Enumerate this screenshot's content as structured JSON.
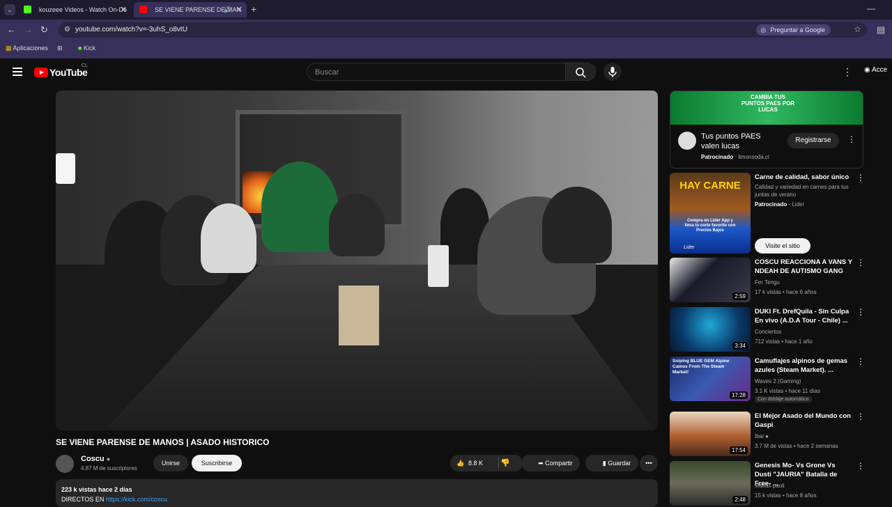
{
  "browser": {
    "tabs": [
      {
        "title": "kouzeee Videos - Watch On-De",
        "active": false,
        "favicon_color": "#53fc18"
      },
      {
        "title": "SE VIENE PARENSE DE MAN",
        "active": true,
        "favicon_color": "#ff0000"
      }
    ],
    "url": "youtube.com/watch?v=-3uhS_o8vtU",
    "ask_google": "Preguntar a Google",
    "bookmarks": [
      {
        "label": "Aplicaciones",
        "icon": "apps-icon"
      },
      {
        "label": "Kick",
        "icon": "kick-icon"
      }
    ]
  },
  "youtube": {
    "logo_text": "YouTube",
    "country": "CL",
    "search_placeholder": "Buscar",
    "account_label": "Acce"
  },
  "video": {
    "title": "SE VIENE PARENSE DE MANOS | ASADO HISTORICO",
    "channel": "Coscu",
    "subscribers": "4.87 M de suscriptores",
    "join_label": "Unirse",
    "subscribe_label": "Suscribirse",
    "likes": "8.8 K",
    "share_label": "Compartir",
    "save_label": "Guardar",
    "description_stats": "223 k vistas  hace 2 días",
    "description_prefix": "DIRECTOS EN ",
    "description_link": "https://kick.com/coscu"
  },
  "ad": {
    "banner_text": "CAMBIA TUS PUNTOS PAES POR LUCAS",
    "title": "Tus puntos PAES valen lucas",
    "sponsored": "Patrocinado",
    "domain": "limonsoda.cl",
    "button": "Registrarse"
  },
  "recommendations": [
    {
      "title": "Carne de calidad, sabor único",
      "line1": "Calidad y variedad en carnes para tus juntas de verano",
      "sponsored": "Patrocinado",
      "advertiser": "Lider",
      "button": "Visite el sitio",
      "thumb_text": "HAY CARNE",
      "thumb_sub": "Compra en Lider App y lleva tu corte favorito con Precios Bajos",
      "thumb_brand": "Lider"
    },
    {
      "title": "COSCU REACCIONA A VANS Y NDEAH DE AUTISMO GANG",
      "channel": "Fer Tengu",
      "meta": "17 k vistas • hace 6 años",
      "duration": "2:59"
    },
    {
      "title": "DUKI Ft. DrefQuila - Sin Culpa En vivo (A.D.A Tour - Chile) ...",
      "channel": "Conciertos",
      "meta": "712 vistas • hace 1 año",
      "duration": "3:34"
    },
    {
      "title": "Camuflajes alpinos de gemas azules (Steam Market). ...",
      "channel": "Waves 2 (Gaming)",
      "meta": "3.1 K vistas • hace 11 días",
      "duration": "17:28",
      "badge": "Con doblaje automático",
      "thumb_text": "Sniping BLUE GEM Alpine Camos From The Steam Market!"
    },
    {
      "title": "El Mejor Asado del Mundo con Gaspi",
      "channel": "Ibai",
      "meta": "3.7 M de vistas • hace 2 semanas",
      "duration": "17:54"
    },
    {
      "title": "Genesis Mo- Vs Grone Vs Dusti \"JAURIA\" Batalla de Free- ...",
      "channel": "Matias paoli",
      "meta": "15 k vistas • hace 8 años",
      "duration": "2:48"
    }
  ],
  "colors": {
    "accent": "#ff0000",
    "link": "#3ea6ff",
    "browser_chrome": "#37305a"
  }
}
